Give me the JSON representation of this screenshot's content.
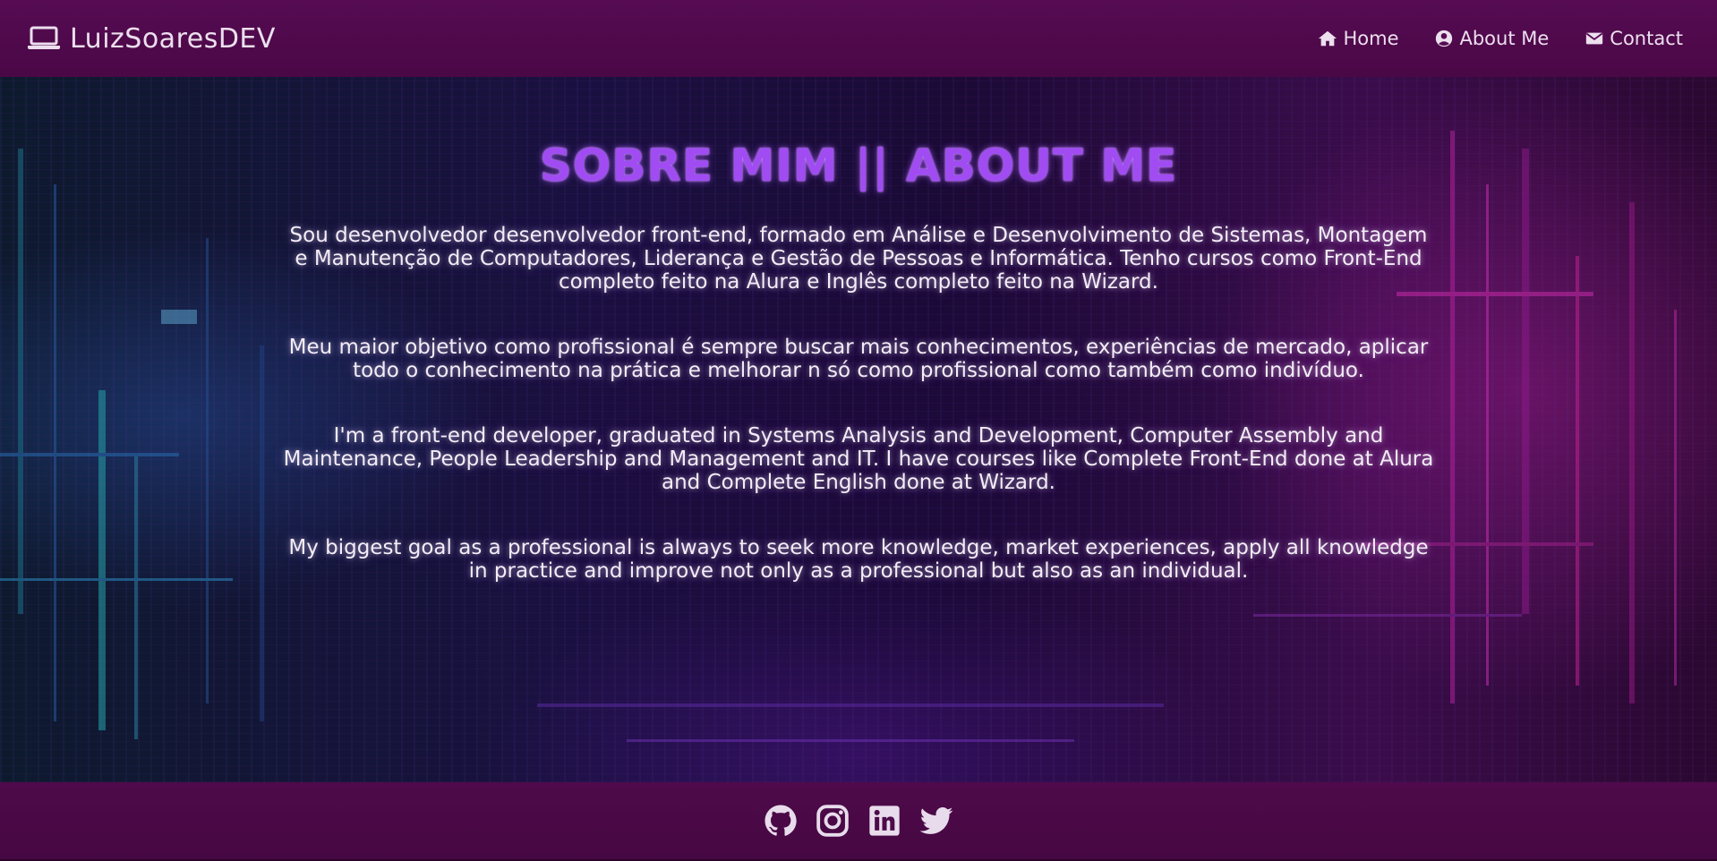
{
  "navbar": {
    "brand_icon": "laptop-icon",
    "brand": "LuizSoaresDEV",
    "links": [
      {
        "icon": "home-icon",
        "label": "Home"
      },
      {
        "icon": "user-circle-icon",
        "label": "About Me"
      },
      {
        "icon": "envelope-icon",
        "label": "Contact"
      }
    ]
  },
  "main": {
    "title": "SOBRE MIM || ABOUT ME",
    "paragraphs": [
      "Sou desenvolvedor desenvolvedor front-end, formado em Análise e Desenvolvimento de Sistemas, Montagem e Manutenção de Computadores, Liderança e Gestão de Pessoas e Informática. Tenho cursos como Front-End completo feito na Alura e Inglês completo feito na Wizard.",
      "Meu maior objetivo como profissional é sempre buscar mais conhecimentos, experiências de mercado, aplicar todo o conhecimento na prática e melhorar n só como profissional como também como indivíduo.",
      "I'm a front-end developer, graduated in Systems Analysis and Development, Computer Assembly and Maintenance, People Leadership and Management and IT. I have courses like Complete Front-End done at Alura and Complete English done at Wizard.",
      "My biggest goal as a professional is always to seek more knowledge, market experiences, apply all knowledge in practice and improve not only as a professional but also as an individual."
    ]
  },
  "footer": {
    "social_icons": [
      "github-icon",
      "instagram-icon",
      "linkedin-icon",
      "twitter-icon"
    ]
  },
  "colors": {
    "navbar_bg": "#560b52",
    "footer_bg": "#4e0a4a",
    "title_color": "#a04cf2",
    "text_color": "#f4ecf8"
  }
}
